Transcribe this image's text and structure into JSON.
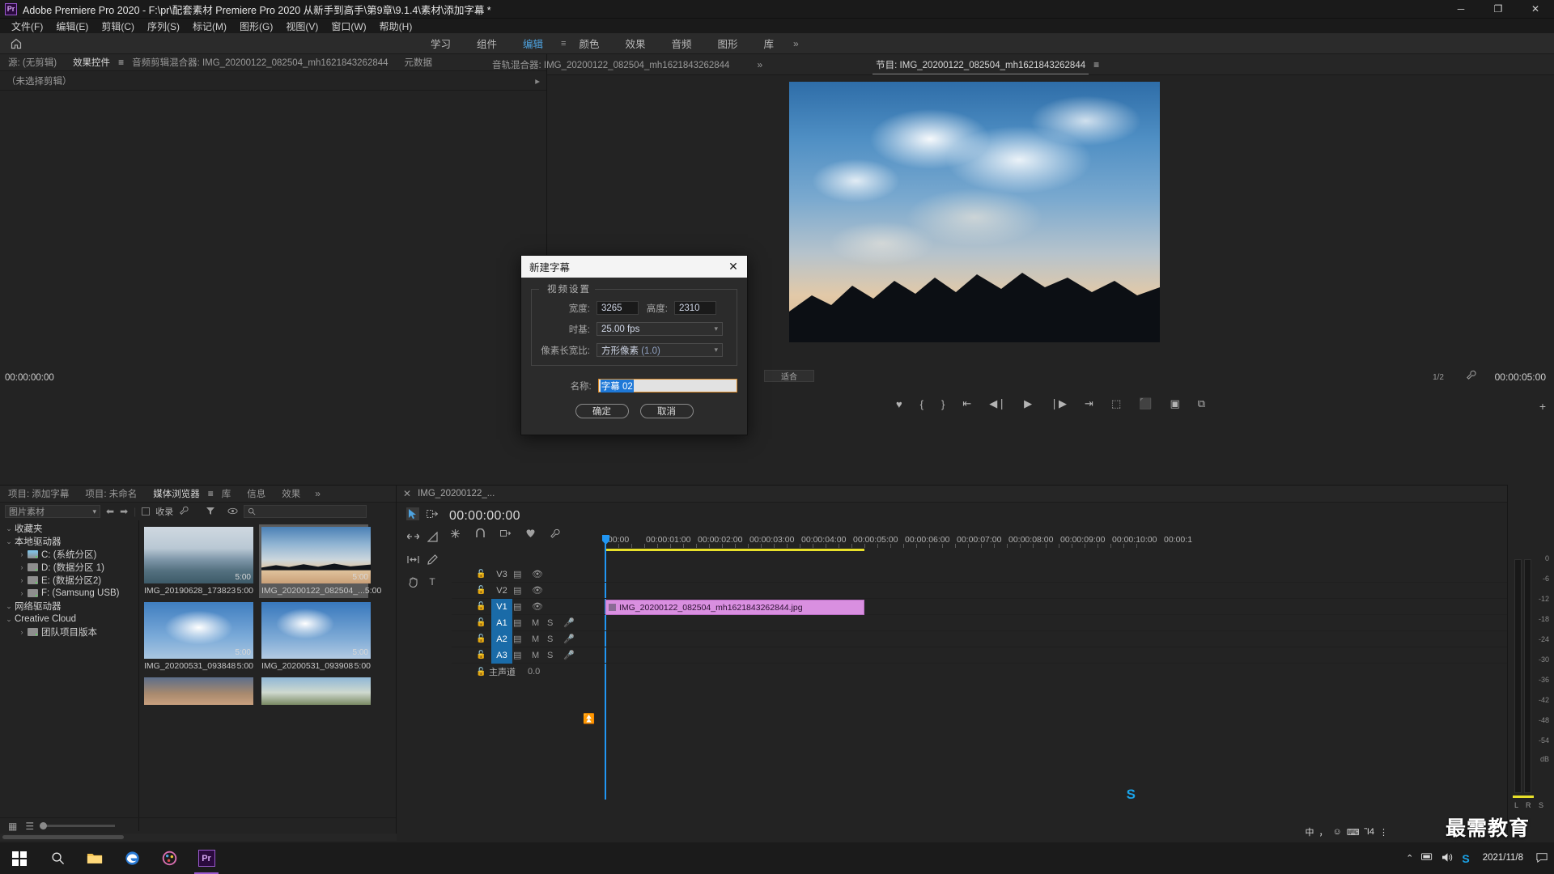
{
  "titlebar": {
    "logo": "Pr",
    "title": "Adobe Premiere Pro 2020 - F:\\pr\\配套素材 Premiere Pro 2020 从新手到高手\\第9章\\9.1.4\\素材\\添加字幕 *",
    "minimize": "─",
    "maximize": "❐",
    "close": "✕"
  },
  "menubar": {
    "items": [
      {
        "label": "文件(F)"
      },
      {
        "label": "编辑(E)"
      },
      {
        "label": "剪辑(C)"
      },
      {
        "label": "序列(S)"
      },
      {
        "label": "标记(M)"
      },
      {
        "label": "图形(G)"
      },
      {
        "label": "视图(V)"
      },
      {
        "label": "窗口(W)"
      },
      {
        "label": "帮助(H)"
      }
    ]
  },
  "workspace": {
    "home_icon": "⌂",
    "tabs": [
      {
        "label": "学习",
        "active": false
      },
      {
        "label": "组件",
        "active": false
      },
      {
        "label": "编辑",
        "active": true
      },
      {
        "label": "颜色",
        "active": false
      },
      {
        "label": "效果",
        "active": false
      },
      {
        "label": "音频",
        "active": false
      },
      {
        "label": "图形",
        "active": false
      },
      {
        "label": "库",
        "active": false
      }
    ],
    "overflow": "»"
  },
  "source_panel": {
    "tabs": [
      {
        "label": "源: (无剪辑)",
        "active": false
      },
      {
        "label": "效果控件",
        "active": true
      },
      {
        "label": "音频剪辑混合器: IMG_20200122_082504_mh1621843262844",
        "active": false
      },
      {
        "label": "元数据",
        "active": false
      }
    ],
    "subtitle": "（未选择剪辑）",
    "arrow": "▸",
    "timecode": "00:00:00:00"
  },
  "mixer_tabs": {
    "items": [
      {
        "label": "音轨混合器: IMG_20200122_082504_mh1621843262844",
        "active": false
      }
    ],
    "overflow": "»"
  },
  "program_panel": {
    "tabs": [
      {
        "label": "节目: IMG_20200122_082504_mh1621843262844",
        "active": true
      }
    ],
    "menu_icon": "≡",
    "fit_label": "适合",
    "resolution": "1/2",
    "timecode": "00:00:05:00",
    "wrench_icon": "wrench-icon",
    "transport": [
      {
        "icon": "♥",
        "name": "marker-button"
      },
      {
        "icon": "{",
        "name": "mark-in-button"
      },
      {
        "icon": "}",
        "name": "mark-out-button"
      },
      {
        "icon": "⇤",
        "name": "go-to-in-button"
      },
      {
        "icon": "◀❘",
        "name": "step-back-button"
      },
      {
        "icon": "▶",
        "name": "play-button"
      },
      {
        "icon": "❘▶",
        "name": "step-forward-button"
      },
      {
        "icon": "⇥",
        "name": "go-to-out-button"
      },
      {
        "icon": "⬚",
        "name": "lift-button"
      },
      {
        "icon": "⬛",
        "name": "extract-button"
      },
      {
        "icon": "▣",
        "name": "export-frame-button"
      },
      {
        "icon": "⧉",
        "name": "comparison-view-button"
      }
    ],
    "plus_icon": "+"
  },
  "project_panel": {
    "tabs": [
      {
        "label": "项目: 添加字幕",
        "active": false
      },
      {
        "label": "项目: 未命名",
        "active": false
      },
      {
        "label": "媒体浏览器",
        "active": true
      },
      {
        "label": "库",
        "active": false
      },
      {
        "label": "信息",
        "active": false
      },
      {
        "label": "效果",
        "active": false
      }
    ],
    "overflow": "»",
    "toolbar": {
      "filter_value": "图片素材",
      "back_icon": "⬅",
      "forward_icon": "➡",
      "ingest_label": "收录",
      "wrench_icon": "wrench-icon",
      "funnel_icon": "filter-icon",
      "eye_icon": "eye-icon",
      "search_placeholder": ""
    },
    "tree": [
      {
        "label": "收藏夹",
        "indent": 0,
        "twisty": "⌄",
        "icon": null
      },
      {
        "label": "本地驱动器",
        "indent": 0,
        "twisty": "⌄",
        "icon": null
      },
      {
        "label": "C: (系统分区)",
        "indent": 1,
        "twisty": "›",
        "icon": "drive-sys"
      },
      {
        "label": "D: (数据分区 1)",
        "indent": 1,
        "twisty": "›",
        "icon": "drive"
      },
      {
        "label": "E: (数据分区2)",
        "indent": 1,
        "twisty": "›",
        "icon": "drive"
      },
      {
        "label": "F: (Samsung USB)",
        "indent": 1,
        "twisty": "›",
        "icon": "drive"
      },
      {
        "label": "网络驱动器",
        "indent": 0,
        "twisty": "⌄",
        "icon": null
      },
      {
        "label": "Creative Cloud",
        "indent": 0,
        "twisty": "⌄",
        "icon": null
      },
      {
        "label": "团队项目版本",
        "indent": 1,
        "twisty": "›",
        "icon": "team"
      }
    ],
    "thumbnails": [
      {
        "name": "IMG_20190628_173823",
        "duration": "5:00",
        "selected": false,
        "kind": "water"
      },
      {
        "name": "IMG_20200122_082504_...",
        "duration": "5:00",
        "selected": true,
        "kind": "mountain"
      },
      {
        "name": "IMG_20200531_093848",
        "duration": "5:00",
        "selected": false,
        "kind": "clouds"
      },
      {
        "name": "IMG_20200531_093908",
        "duration": "5:00",
        "selected": false,
        "kind": "clouds2"
      },
      {
        "name": "",
        "duration": "",
        "selected": false,
        "kind": "sunset"
      },
      {
        "name": "",
        "duration": "",
        "selected": false,
        "kind": "hill"
      }
    ],
    "footer": {
      "grid_icon": "grid-view-icon",
      "list_icon": "list-view-icon",
      "zoom_icon": "zoom-slider"
    }
  },
  "timeline": {
    "close_icon": "✕",
    "sequence_name": "IMG_20200122_...",
    "timecode": "00:00:00:00",
    "tools": [
      {
        "icon": "➤",
        "name": "selection-tool",
        "active": true
      },
      {
        "icon": "⬚→",
        "name": "track-select-forward-tool",
        "active": false
      },
      {
        "icon": "↔",
        "name": "ripple-edit-tool",
        "active": false
      },
      {
        "icon": "◢",
        "name": "rate-stretch-tool",
        "active": false
      },
      {
        "icon": "❘↔❘",
        "name": "slip-tool",
        "active": false
      },
      {
        "icon": "✎",
        "name": "pen-tool",
        "active": false
      },
      {
        "icon": "✋",
        "name": "hand-tool",
        "active": false
      },
      {
        "icon": "T",
        "name": "type-tool",
        "active": false
      }
    ],
    "toolrow": [
      {
        "icon": "✳",
        "name": "nested-sequence-icon"
      },
      {
        "icon": "∩",
        "name": "snap-icon"
      },
      {
        "icon": "◧▸",
        "name": "linked-selection-icon"
      },
      {
        "icon": "♥",
        "name": "add-marker-icon"
      },
      {
        "icon": "⚒",
        "name": "timeline-settings-icon"
      }
    ],
    "ruler_labels": [
      ":00:00",
      "00:00:01:00",
      "00:00:02:00",
      "00:00:03:00",
      "00:00:04:00",
      "00:00:05:00",
      "00:00:06:00",
      "00:00:07:00",
      "00:00:08:00",
      "00:00:09:00",
      "00:00:10:00",
      "00:00:1"
    ],
    "tracks": [
      {
        "name": "V3",
        "type": "video",
        "selected": false,
        "lock": "⚿",
        "icons": [
          "track-output-icon",
          "eye-icon"
        ]
      },
      {
        "name": "V2",
        "type": "video",
        "selected": false,
        "lock": "⚿",
        "icons": [
          "track-output-icon",
          "eye-icon"
        ]
      },
      {
        "name": "V1",
        "type": "video",
        "selected": true,
        "lock": "⚿",
        "icons": [
          "track-output-icon",
          "eye-icon"
        ]
      },
      {
        "name": "A1",
        "type": "audio",
        "selected": true,
        "lock": "⚿",
        "mute": "M",
        "solo": "S",
        "mic": "Ἲ4"
      },
      {
        "name": "A2",
        "type": "audio",
        "selected": true,
        "lock": "⚿",
        "mute": "M",
        "solo": "S",
        "mic": "Ἲ4"
      },
      {
        "name": "A3",
        "type": "audio",
        "selected": true,
        "lock": "⚿",
        "mute": "M",
        "solo": "S",
        "mic": "Ἲ4"
      }
    ],
    "master": {
      "label": "主声道",
      "value": "0.0",
      "icon": "⏸"
    },
    "clip": {
      "label": "IMG_20200122_082504_mh1621843262844.jpg",
      "color": "#d98fe0"
    }
  },
  "audio_meter": {
    "db_label": "dB",
    "ticks": [
      "0",
      "-6",
      "-12",
      "-18",
      "-24",
      "-30",
      "-36",
      "-42",
      "-48",
      "-54"
    ],
    "channels": [
      "L",
      "R"
    ],
    "s_label": "S"
  },
  "dialog": {
    "title": "新建字幕",
    "close_icon": "✕",
    "legend": "视频设置",
    "fields": {
      "width_label": "宽度:",
      "width_value": "3265",
      "height_label": "高度:",
      "height_value": "2310",
      "timebase_label": "时基:",
      "timebase_value": "25.00 fps",
      "par_label": "像素长宽比:",
      "par_value": "方形像素",
      "par_value_num": "(1.0)",
      "name_label": "名称:",
      "name_value": "字幕 02"
    },
    "ok_label": "确定",
    "cancel_label": "取消"
  },
  "taskbar": {
    "start_icon": "windows-icon",
    "items": [
      {
        "name": "search-icon",
        "glyph": "⚲"
      },
      {
        "name": "file-explorer-icon",
        "glyph": "Ὄ1"
      },
      {
        "name": "edge-icon",
        "glyph": "e"
      },
      {
        "name": "paint-icon",
        "glyph": "Ἲ8"
      },
      {
        "name": "premiere-icon",
        "glyph": "Pr",
        "active": true
      }
    ],
    "tray": {
      "chevron": "⌃",
      "network_icon": "⬚",
      "volume_icon": "ὐa",
      "ime_icon": "中",
      "date": "2021/11/8",
      "time": ""
    },
    "ime_bar": {
      "s_logo": "S",
      "lang": "中",
      "comma": "，",
      "smiley": "☺",
      "keyboard": "⌨",
      "mic": "Ἲ4",
      "more": "⋮"
    },
    "watermark": "最需教育"
  }
}
